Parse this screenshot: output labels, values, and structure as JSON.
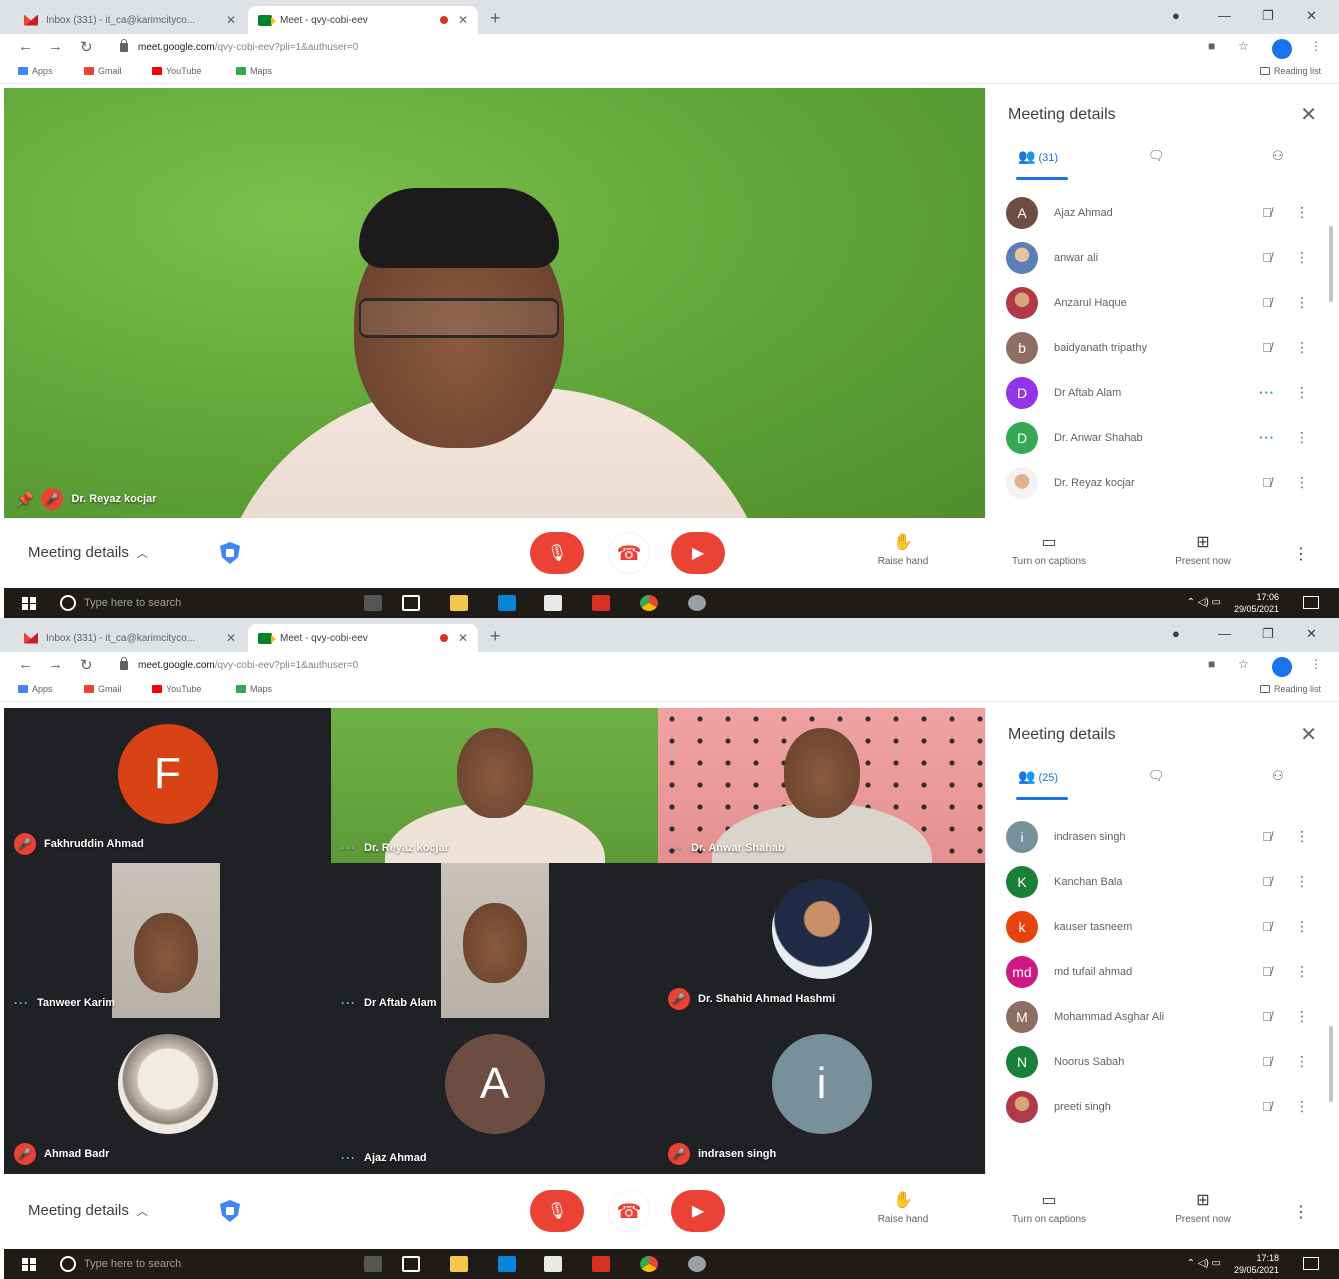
{
  "browser": {
    "tab_inactive_title": "Inbox (331) - it_ca@karimcityco...",
    "tab_active_title": "Meet - qvy-cobi-eev",
    "url_host": "meet.google.com",
    "url_path": "/qvy-cobi-eev?pli=1&authuser=0",
    "bookmarks": [
      "Apps",
      "Gmail",
      "YouTube",
      "Maps"
    ],
    "reading_list": "Reading list",
    "profile_initial": "i"
  },
  "screen1": {
    "main_speaker": "Dr. Reyaz kocjar",
    "side_panel": {
      "title": "Meeting details",
      "people_count": "(31)",
      "participants": [
        {
          "initial": "A",
          "name": "Ajaz Ahmad",
          "color": "#6d4c41",
          "status": "muted"
        },
        {
          "initial": "",
          "name": "anwar ali",
          "color": "#5b7db8",
          "status": "muted",
          "photo": "photo"
        },
        {
          "initial": "",
          "name": "Anzarul Haque",
          "color": "#d93025",
          "status": "muted",
          "photo": "photo2"
        },
        {
          "initial": "b",
          "name": "baidyanath tripathy",
          "color": "#8d6e63",
          "status": "muted"
        },
        {
          "initial": "D",
          "name": "Dr Aftab Alam",
          "color": "#9334e6",
          "status": "talking"
        },
        {
          "initial": "D",
          "name": "Dr. Anwar Shahab",
          "color": "#34a853",
          "status": "talking"
        },
        {
          "initial": "",
          "name": "Dr. Reyaz kocjar",
          "color": "#f2f2f2",
          "status": "muted",
          "photo": "photo3"
        }
      ]
    },
    "taskbar": {
      "search_placeholder": "Type here to search",
      "time": "17:06",
      "date": "29/05/2021"
    }
  },
  "screen2": {
    "tiles": [
      {
        "name": "Fakhruddin Ahmad",
        "kind": "avatar",
        "initial": "F",
        "color": "#d84315",
        "status": "muted"
      },
      {
        "name": "Dr. Reyaz kocjar",
        "kind": "video-green",
        "status": "talking"
      },
      {
        "name": "Dr. Anwar Shahab",
        "kind": "video-pink",
        "status": "talking"
      },
      {
        "name": "Tanweer Karim",
        "kind": "video-portrait",
        "status": "talking"
      },
      {
        "name": "Dr Aftab Alam",
        "kind": "video-portrait",
        "status": "talking"
      },
      {
        "name": "Dr. Shahid Ahmad Hashmi",
        "kind": "photo-avatar",
        "status": "muted"
      },
      {
        "name": "Ahmad Badr",
        "kind": "sketch-avatar",
        "status": "muted"
      },
      {
        "name": "Ajaz Ahmad",
        "kind": "avatar",
        "initial": "A",
        "color": "#6d4c41",
        "status": "talking"
      },
      {
        "name": "indrasen singh",
        "kind": "avatar",
        "initial": "i",
        "color": "#78909c",
        "status": "muted"
      }
    ],
    "side_panel": {
      "title": "Meeting details",
      "people_count": "(25)",
      "participants": [
        {
          "initial": "i",
          "name": "indrasen singh",
          "color": "#78909c",
          "status": "muted"
        },
        {
          "initial": "K",
          "name": "Kanchan Bala",
          "color": "#188038",
          "status": "muted"
        },
        {
          "initial": "k",
          "name": "kauser tasneem",
          "color": "#e8430a",
          "status": "muted"
        },
        {
          "initial": "md",
          "name": "md tufail ahmad",
          "color": "#d01884",
          "status": "muted"
        },
        {
          "initial": "M",
          "name": "Mohammad Asghar Ali",
          "color": "#8d6e63",
          "status": "muted"
        },
        {
          "initial": "N",
          "name": "Noorus Sabah",
          "color": "#188038",
          "status": "muted"
        },
        {
          "initial": "",
          "name": "preeti singh",
          "color": "#f2f2f2",
          "status": "muted",
          "photo": "photo2"
        }
      ]
    },
    "taskbar": {
      "search_placeholder": "Type here to search",
      "time": "17:18",
      "date": "29/05/2021"
    }
  },
  "controls": {
    "meeting_details": "Meeting details",
    "raise_hand": "Raise hand",
    "captions": "Turn on captions",
    "present": "Present now"
  },
  "icons": {
    "mic": "mic-off-icon",
    "hang": "hang-up-icon",
    "cam": "camera-off-icon",
    "people": "people-icon",
    "chat": "chat-icon",
    "activities": "activities-icon"
  }
}
